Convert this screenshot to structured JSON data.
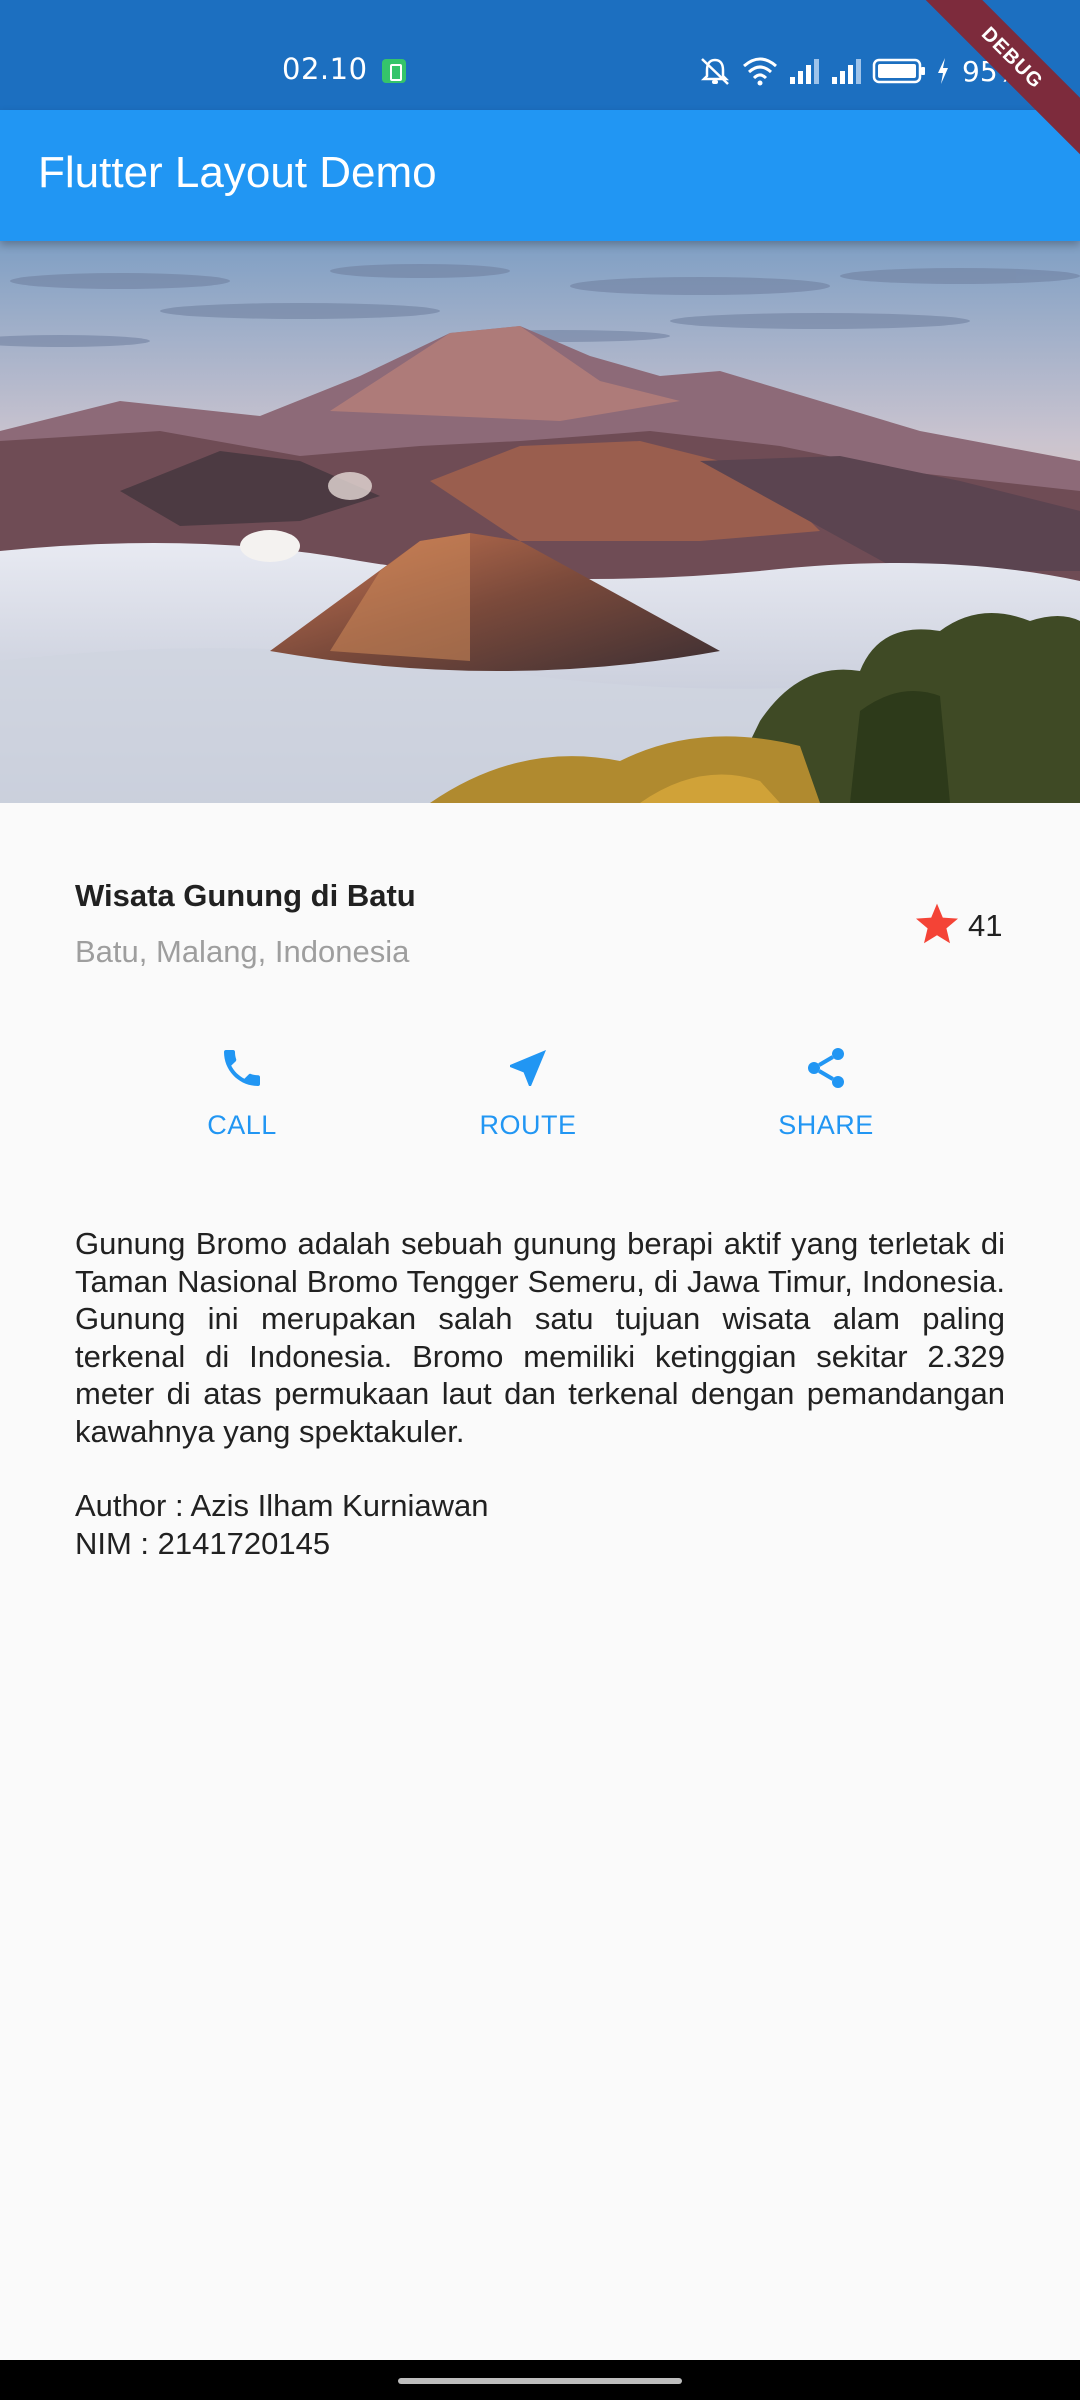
{
  "status_bar": {
    "time": "02.10",
    "battery": "95%",
    "icons": [
      "sim-status-icon",
      "mute-icon",
      "wifi-icon",
      "signal-icon",
      "signal-icon",
      "battery-icon",
      "charging-icon"
    ]
  },
  "debug_banner": "DEBUG",
  "app_bar": {
    "title": "Flutter Layout Demo"
  },
  "hero": {
    "icon": "mountain-landscape-image"
  },
  "title_section": {
    "title": "Wisata Gunung di Batu",
    "subtitle": "Batu, Malang, Indonesia",
    "star_count": "41",
    "star_color": "#f44336"
  },
  "buttons": [
    {
      "label": "CALL",
      "icon": "phone-icon"
    },
    {
      "label": "ROUTE",
      "icon": "near-me-icon"
    },
    {
      "label": "SHARE",
      "icon": "share-icon"
    }
  ],
  "accent_color": "#2196f3",
  "text_section": {
    "description": "Gunung Bromo adalah sebuah gunung berapi aktif yang terletak di Taman Nasional Bromo Tengger Semeru, di Jawa Timur, Indonesia. Gunung ini merupakan salah satu tujuan wisata alam paling terkenal di Indonesia. Bromo memiliki ketinggian sekitar 2.329 meter di atas permukaan laut dan terkenal dengan pemandangan kawahnya yang spektakuler.",
    "author": "Author : Azis Ilham Kurniawan",
    "nim": "NIM : 2141720145"
  }
}
